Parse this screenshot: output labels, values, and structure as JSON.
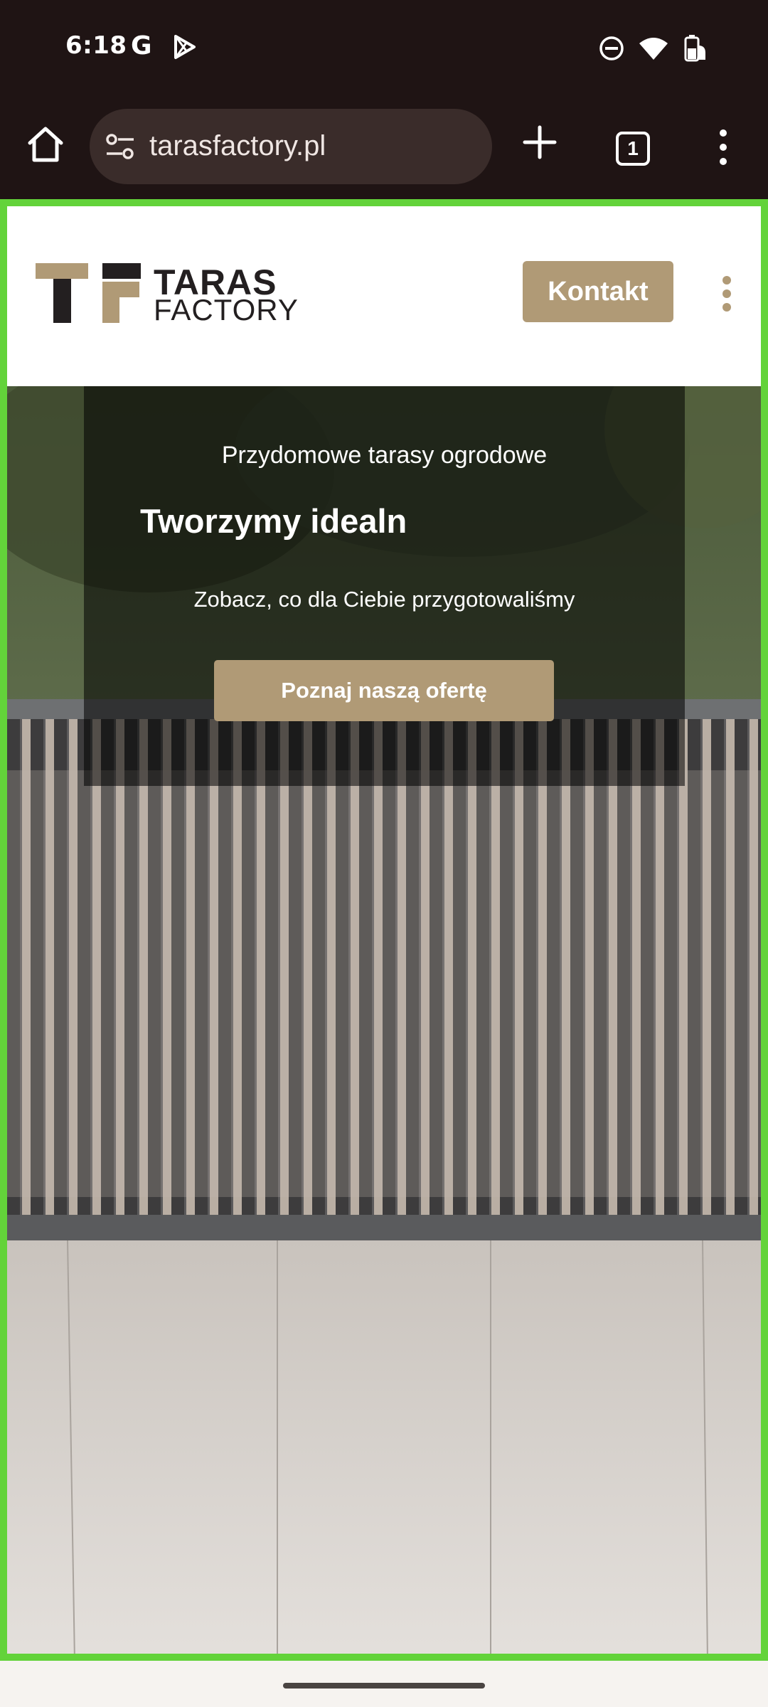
{
  "status_bar": {
    "time": "6:18",
    "google_letter": "G",
    "icons": [
      "google-icon",
      "play-store-icon",
      "do-not-disturb-icon",
      "wifi-icon",
      "battery-icon"
    ]
  },
  "browser": {
    "url": "tarasfactory.pl",
    "tab_count": "1",
    "icons": [
      "home-icon",
      "site-settings-icon",
      "new-tab-icon",
      "tabs-icon",
      "overflow-menu-icon"
    ]
  },
  "site": {
    "logo_line1": "TARAS",
    "logo_line2": "FACTORY",
    "kontakt_label": "Kontakt",
    "brand_color": "#b09a76"
  },
  "hero": {
    "subtitle": "Przydomowe tarasy ogrodowe",
    "title": "Tworzymy idealn",
    "description": "Zobacz, co dla Ciebie przygotowaliśmy",
    "cta_label": "Poznaj naszą ofertę"
  },
  "floating": {
    "call_icon": "phone-icon"
  },
  "colors": {
    "status_bar_bg": "#1f1414",
    "url_bar_bg": "#3a2c2a",
    "viewport_border": "#63d33a",
    "accent": "#b09a76"
  }
}
